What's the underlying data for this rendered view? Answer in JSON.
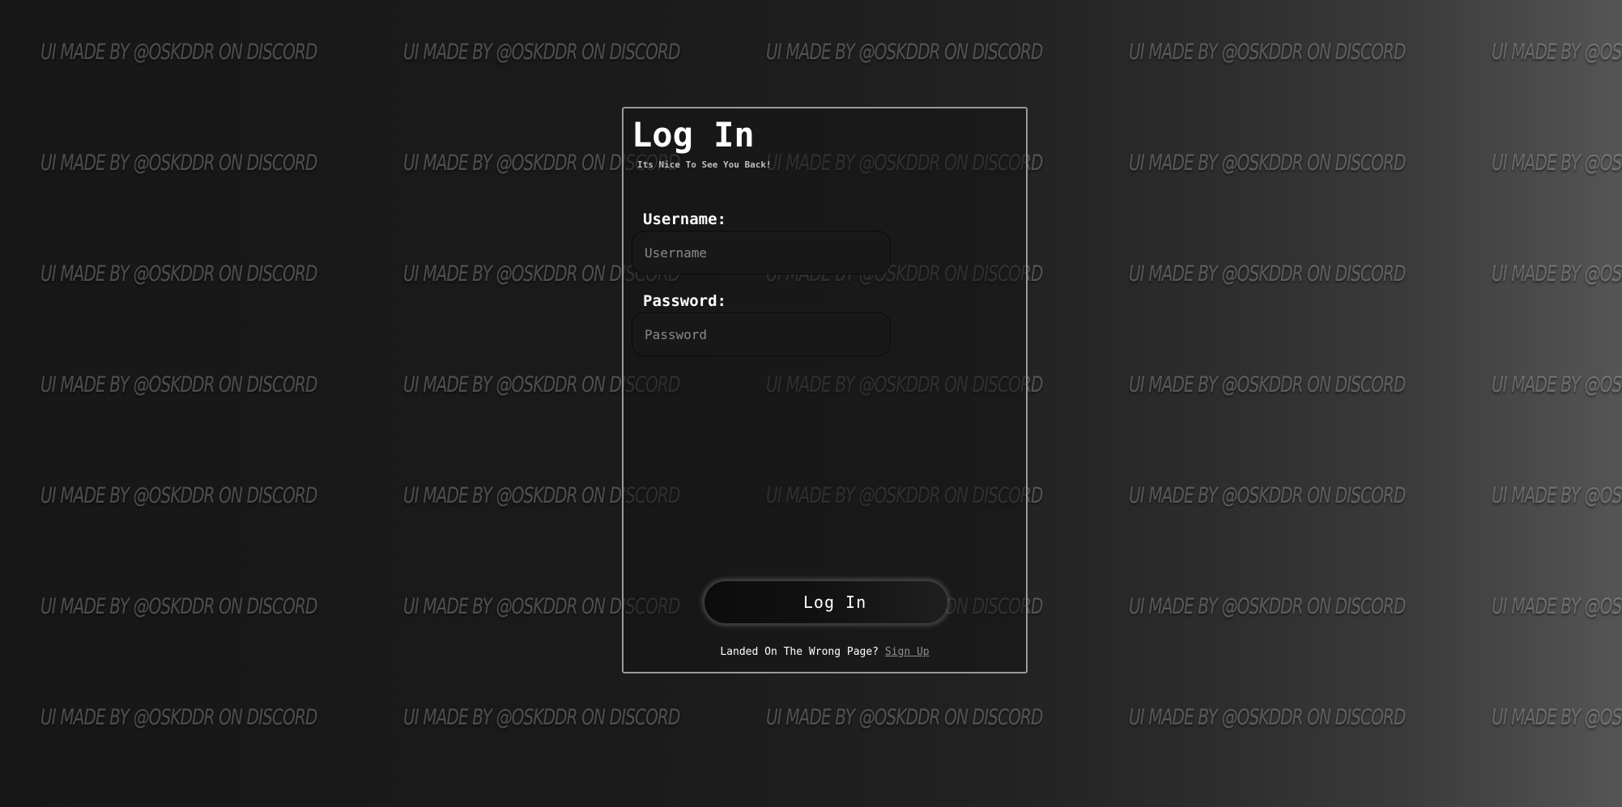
{
  "watermark": {
    "text": "UI MADE BY @OSKDDR ON DISCORD"
  },
  "login": {
    "title": "Log In",
    "subtitle": "Its Nice To See You Back!",
    "username_label": "Username:",
    "username_placeholder": "Username",
    "username_value": "",
    "password_label": "Password:",
    "password_placeholder": "Password",
    "password_value": "",
    "submit_label": "Log In",
    "footer_text": "Landed On The Wrong Page?",
    "signup_link": "Sign Up"
  },
  "colors": {
    "background_dark": "#171717",
    "background_light": "#555555",
    "card_border": "#9a9a9a",
    "link": "#8f8f8f"
  }
}
